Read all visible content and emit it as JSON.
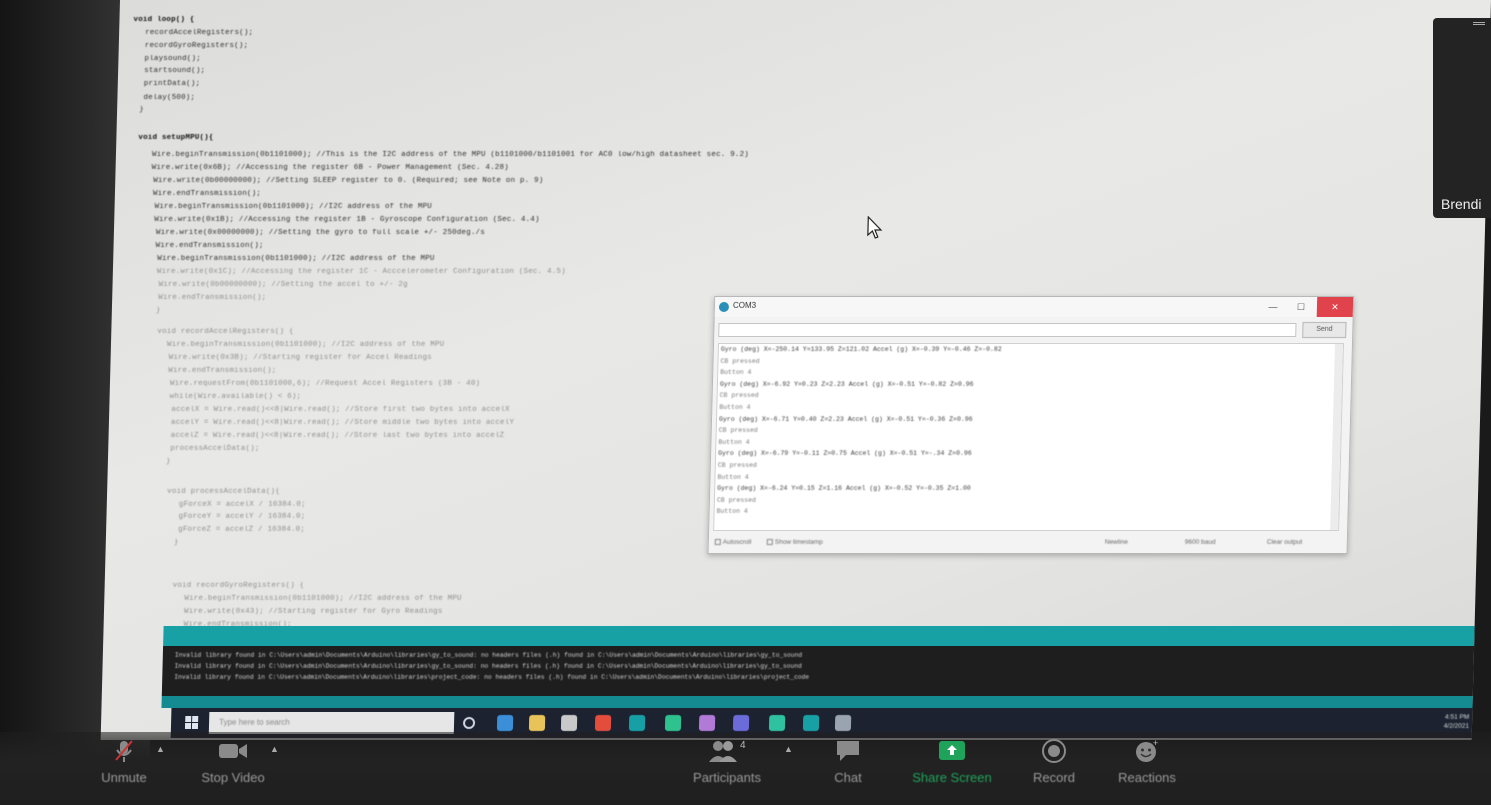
{
  "editor": {
    "code_lines": [
      "void loop() {",
      "  recordAccelRegisters();",
      "  recordGyroRegisters();",
      "  playsound();",
      "  startsound();",
      "  printData();",
      "  delay(500);",
      "}",
      "void setupMPU(){",
      "  Wire.beginTransmission(0b1101000); //This is the I2C address of the MPU (b1101000/b1101001 for AC0 low/high datasheet sec. 9.2)",
      "  Wire.write(0x6B); //Accessing the register 6B - Power Management (Sec. 4.28)",
      "  Wire.write(0b00000000); //Setting SLEEP register to 0. (Required; see Note on p. 9)",
      "  Wire.endTransmission();",
      "  Wire.beginTransmission(0b1101000); //I2C address of the MPU",
      "  Wire.write(0x1B); //Accessing the register 1B - Gyroscope Configuration (Sec. 4.4)",
      "  Wire.write(0x00000000); //Setting the gyro to full scale +/- 250deg./s",
      "  Wire.endTransmission();",
      "  Wire.beginTransmission(0b1101000); //I2C address of the MPU",
      "  Wire.write(0x1C); //Accessing the register 1C - Acccelerometer Configuration (Sec. 4.5)",
      "  Wire.write(0b00000000); //Setting the accel to +/- 2g",
      "  Wire.endTransmission();",
      "}",
      "void recordAccelRegisters() {",
      "  Wire.beginTransmission(0b1101000); //I2C address of the MPU",
      "  Wire.write(0x3B); //Starting register for Accel Readings",
      "  Wire.endTransmission();",
      "  Wire.requestFrom(0b1101000,6); //Request Accel Registers (3B - 40)",
      "  while(Wire.available() < 6);",
      "  accelX = Wire.read()<<8|Wire.read(); //Store first two bytes into accelX",
      "  accelY = Wire.read()<<8|Wire.read(); //Store middle two bytes into accelY",
      "  accelZ = Wire.read()<<8|Wire.read(); //Store last two bytes into accelZ",
      "  processAccelData();",
      "}",
      "void processAccelData(){",
      "  gForceX = accelX / 16384.0;",
      "  gForceY = accelY / 16384.0;",
      "  gForceZ = accelZ / 16384.0;",
      "}",
      "void recordGyroRegisters() {",
      "  Wire.beginTransmission(0b1101000); //I2C address of the MPU",
      "  Wire.write(0x43); //Starting register for Gyro Readings",
      "  Wire.endTransmission();"
    ]
  },
  "serial_monitor": {
    "title": "COM3",
    "window_buttons": {
      "minimize": "—",
      "maximize": "☐",
      "close": "✕"
    },
    "send_label": "Send",
    "output_lines": [
      "Gyro (deg) X=-250.14 Y=133.95 Z=121.02 Accel (g) X=-0.39 Y=-0.46 Z=-0.82",
      " CB pressed",
      " Button 4",
      "Gyro (deg) X=-6.92 Y=0.23 Z=2.23 Accel (g) X=-0.51 Y=-0.82 Z=0.96",
      " CB pressed",
      " Button 4",
      "Gyro (deg) X=-6.71 Y=0.40 Z=2.23 Accel (g) X=-0.51 Y=-0.36 Z=0.96",
      " CB pressed",
      " Button 4",
      "Gyro (deg) X=-6.79 Y=-0.11 Z=0.75 Accel (g) X=-0.51 Y=-.34 Z=0.96",
      " CB pressed",
      " Button 4",
      "Gyro (deg) X=-6.24 Y=0.15 Z=1.16 Accel (g) X=-0.52 Y=-0.35 Z=1.00",
      " CB pressed",
      " Button 4"
    ],
    "autoscroll_label": "Autoscroll",
    "timestamp_label": "Show timestamp",
    "line_ending": "Newline",
    "baud_rate": "9600 baud",
    "clear_label": "Clear output"
  },
  "console": {
    "lines": [
      "Invalid library found in C:\\Users\\admin\\Documents\\Arduino\\libraries\\gy_to_sound: no headers files (.h) found in C:\\Users\\admin\\Documents\\Arduino\\libraries\\gy_to_sound",
      "Invalid library found in C:\\Users\\admin\\Documents\\Arduino\\libraries\\gy_to_sound: no headers files (.h) found in C:\\Users\\admin\\Documents\\Arduino\\libraries\\gy_to_sound",
      "Invalid library found in C:\\Users\\admin\\Documents\\Arduino\\libraries\\project_code: no headers files (.h) found in C:\\Users\\admin\\Documents\\Arduino\\libraries\\project_code"
    ]
  },
  "taskbar": {
    "search_placeholder": "Type here to search",
    "time": "4:51 PM",
    "date": "4/2/2021",
    "pinned_icons": [
      "task-view-icon",
      "edge-icon",
      "file-explorer-icon",
      "store-icon",
      "chrome-icon",
      "arduino-icon",
      "app-icon",
      "premiere-icon",
      "after-effects-icon",
      "app-icon",
      "arduino-icon",
      "app-icon"
    ]
  },
  "video_tile": {
    "name": "Brendi"
  },
  "zoom_toolbar": {
    "unmute_label": "Unmute",
    "stop_video_label": "Stop Video",
    "participants_label": "Participants",
    "participants_count": "4",
    "chat_label": "Chat",
    "share_screen_label": "Share Screen",
    "record_label": "Record",
    "reactions_label": "Reactions"
  },
  "colors": {
    "arduino_teal": "#17a1a5",
    "share_green": "#1fa35a",
    "close_red": "#e0434b"
  }
}
